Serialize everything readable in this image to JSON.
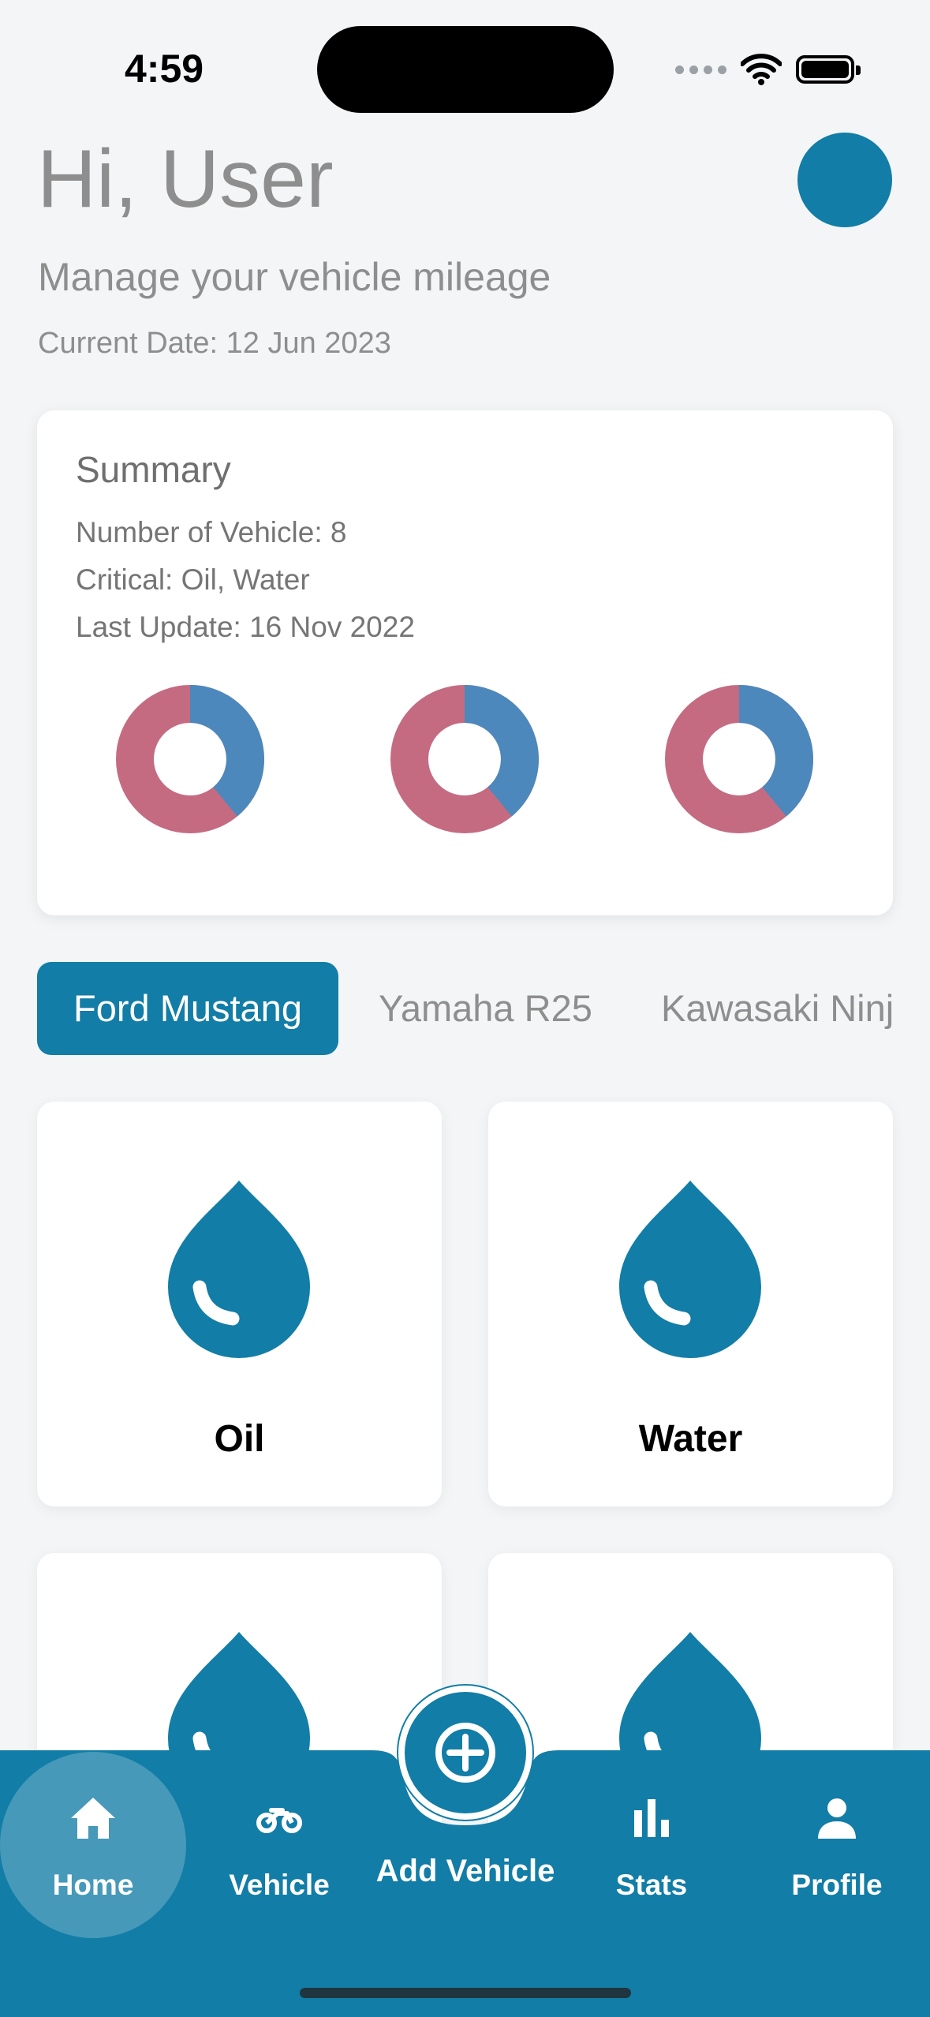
{
  "status_bar": {
    "time": "4:59",
    "icons": [
      "signal-dots-icon",
      "wifi-icon",
      "battery-icon"
    ]
  },
  "header": {
    "greeting": "Hi, User",
    "subtitle": "Manage your vehicle mileage",
    "current_date": "Current Date: 12 Jun 2023"
  },
  "summary": {
    "title": "Summary",
    "vehicle_count": "Number of Vehicle: 8",
    "critical": "Critical: Oil, Water",
    "last_update": "Last Update: 16 Nov 2022",
    "donuts": [
      {
        "blue_fraction": 0.39
      },
      {
        "blue_fraction": 0.39
      },
      {
        "blue_fraction": 0.39
      }
    ]
  },
  "vehicle_tabs": [
    {
      "label": "Ford Mustang",
      "active": true
    },
    {
      "label": "Yamaha R25",
      "active": false
    },
    {
      "label": "Kawasaki Ninj",
      "active": false
    }
  ],
  "fluid_tiles": [
    {
      "label": "Oil",
      "icon": "drop-icon"
    },
    {
      "label": "Water",
      "icon": "drop-icon"
    },
    {
      "label": "",
      "icon": "drop-icon"
    },
    {
      "label": "",
      "icon": "drop-icon"
    }
  ],
  "bottom_nav": {
    "home": "Home",
    "vehicle": "Vehicle",
    "add_vehicle": "Add Vehicle",
    "stats": "Stats",
    "profile": "Profile"
  },
  "colors": {
    "accent": "#127da6",
    "donut_blue": "#4c88bc",
    "donut_red": "#c46b82",
    "background": "#f3f5f7"
  }
}
